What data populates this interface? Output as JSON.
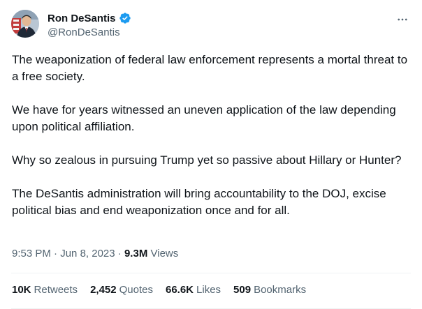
{
  "author": {
    "display_name": "Ron DeSantis",
    "handle": "@RonDeSantis",
    "verified": true
  },
  "tweet": {
    "paragraphs": [
      "The weaponization of federal law enforcement represents a mortal threat to a free society.",
      "We have for years witnessed an uneven application of the law depending upon political affiliation.",
      "Why so zealous in pursuing Trump yet so passive about Hillary or Hunter?",
      "The DeSantis administration will bring accountability to the DOJ, excise political bias and end weaponization once and for all."
    ],
    "time": "9:53 PM",
    "date": "Jun 8, 2023",
    "views_count": "9.3M",
    "views_label": "Views"
  },
  "stats": {
    "retweets": {
      "count": "10K",
      "label": "Retweets"
    },
    "quotes": {
      "count": "2,452",
      "label": "Quotes"
    },
    "likes": {
      "count": "66.6K",
      "label": "Likes"
    },
    "bookmarks": {
      "count": "509",
      "label": "Bookmarks"
    }
  },
  "icons": {
    "verified": "verified-badge-icon",
    "more": "more-horizontal-icon"
  },
  "colors": {
    "verified_blue": "#1d9bf0",
    "secondary_text": "#536471",
    "primary_text": "#0f1419",
    "divider": "#eff3f4"
  }
}
